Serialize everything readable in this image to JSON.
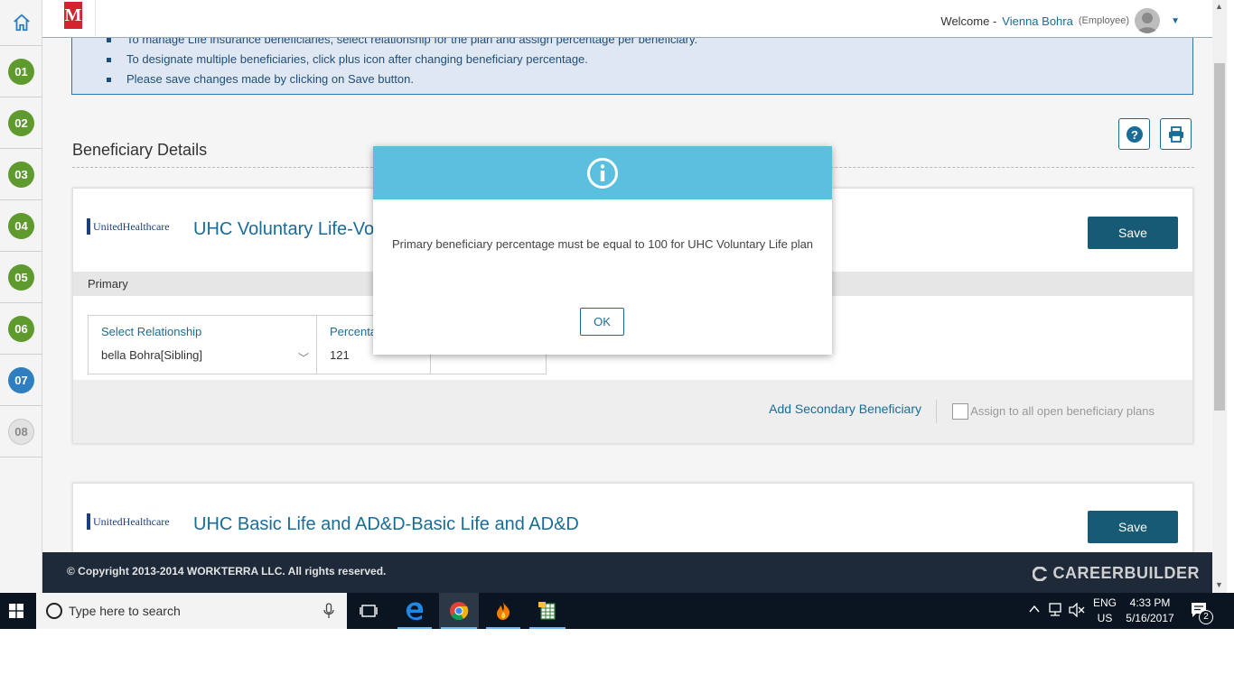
{
  "rail": {
    "steps": [
      "01",
      "02",
      "03",
      "04",
      "05",
      "06",
      "07",
      "08"
    ]
  },
  "header": {
    "logo_letter": "M",
    "welcome": "Welcome -",
    "user_name": "Vienna Bohra",
    "user_role": "(Employee)"
  },
  "info": {
    "items": [
      "To manage Life insurance beneficiaries, select relationship for the plan and assign percentage per beneficiary.",
      "To designate multiple beneficiaries, click plus icon after changing beneficiary percentage.",
      "Please save changes made by clicking on Save button."
    ]
  },
  "section": {
    "title": "Beneficiary Details"
  },
  "plans": [
    {
      "carrier": "UnitedHealthcare",
      "title": "UHC Voluntary Life-Vo",
      "save_label": "Save",
      "band_label": "Primary",
      "relationship_label": "Select Relationship",
      "relationship_value": "bella Bohra[Sibling]",
      "percentage_label": "Percentage",
      "percentage_value": "121",
      "add_secondary": "Add Secondary Beneficiary",
      "assign_all": "Assign to all open beneficiary plans"
    },
    {
      "carrier": "UnitedHealthcare",
      "title": "UHC Basic Life and AD&D-Basic Life and AD&D",
      "save_label": "Save"
    }
  ],
  "footer": {
    "copyright": "© Copyright 2013-2014 WORKTERRA LLC. All rights reserved.",
    "brand": "CAREERBUILDER"
  },
  "modal": {
    "message": "Primary beneficiary percentage must be equal to 100 for UHC Voluntary Life plan",
    "ok_label": "OK"
  },
  "taskbar": {
    "search_placeholder": "Type here to search",
    "lang_top": "ENG",
    "lang_bottom": "US",
    "time": "4:33 PM",
    "date": "5/16/2017",
    "notifications": "2"
  },
  "colors": {
    "accent": "#1a6c97",
    "step_done": "#5e9a2d",
    "step_active": "#2f7ec0",
    "modal_header": "#5bc0de",
    "footer_bg": "#1e2a3a"
  }
}
